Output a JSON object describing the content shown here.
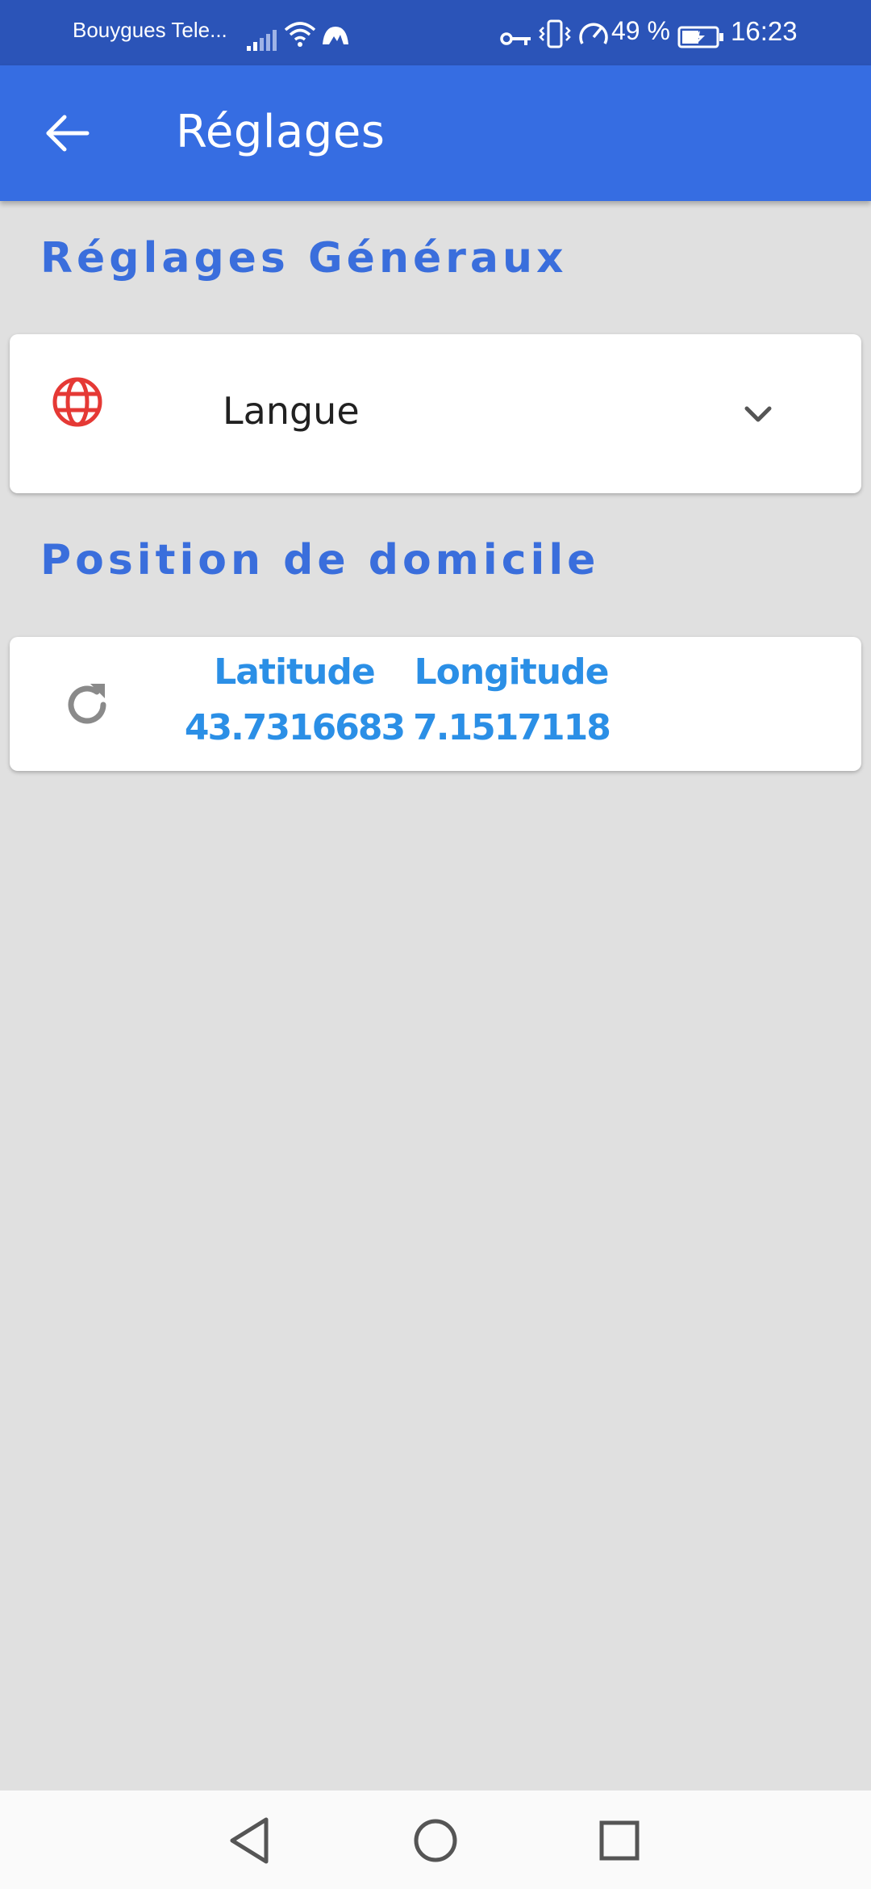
{
  "status_bar": {
    "carrier": "Bouygues Tele...",
    "battery_percent": "49 %",
    "time": "16:23",
    "icons": [
      "signal-icon",
      "wifi-icon",
      "vpn-cloud-icon",
      "key-icon",
      "vibrate-icon",
      "speedometer-icon",
      "battery-charging-icon"
    ]
  },
  "app_bar": {
    "title": "Réglages",
    "back_icon": "arrow-back-icon"
  },
  "general_section": {
    "heading": "Réglages Généraux",
    "language": {
      "label": "Langue",
      "icon": "globe-icon",
      "dropdown_icon": "chevron-down-icon"
    }
  },
  "home_section": {
    "heading": "Position de domicile",
    "refresh_icon": "refresh-icon",
    "latitude_label": "Latitude",
    "latitude_value": "43.7316683",
    "longitude_label": "Longitude",
    "longitude_value": "7.1517118"
  },
  "nav_bar": {
    "buttons": [
      "back-triangle-icon",
      "home-circle-icon",
      "recents-square-icon"
    ]
  },
  "colors": {
    "status_bar": "#2b54b8",
    "app_bar": "#366de2",
    "heading": "#3a6edc",
    "coordinates": "#2b8fe6",
    "globe": "#e53935",
    "background": "#e0e0e0"
  }
}
